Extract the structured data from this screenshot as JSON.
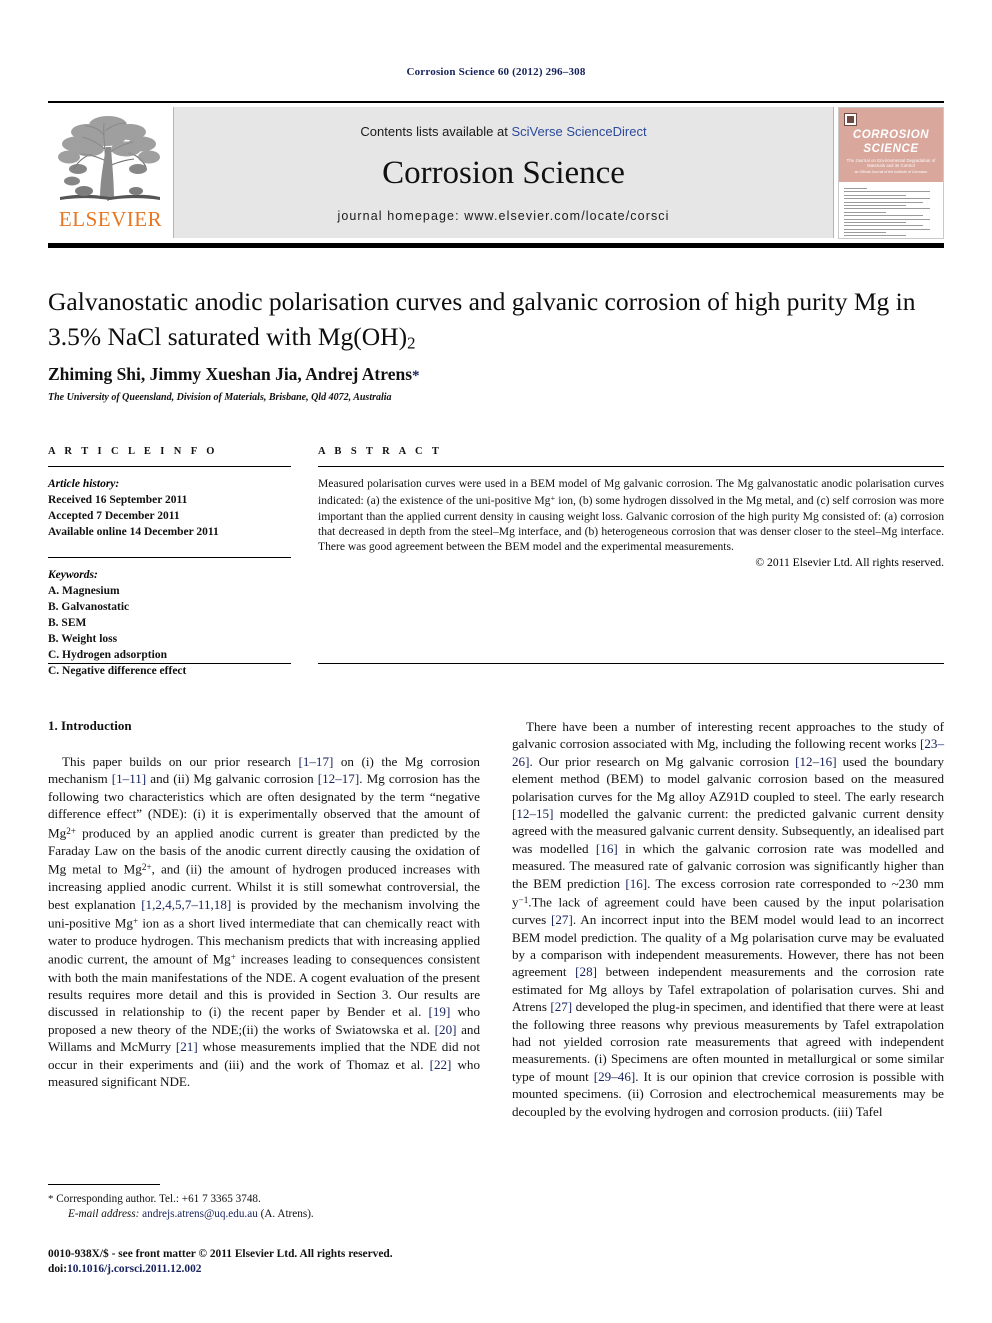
{
  "running_head": "Corrosion Science 60 (2012) 296–308",
  "masthead": {
    "publisher_logo_label": "ELSEVIER",
    "contents_prefix": "Contents lists available at ",
    "sciencedirect_link": "SciVerse ScienceDirect",
    "journal_name": "Corrosion Science",
    "homepage_line": "journal homepage: www.elsevier.com/locate/corsci",
    "cover": {
      "title_line1": "CORROSION",
      "title_line2": "SCIENCE",
      "subtitle": "The Journal on Environmental Degradation of Materials and its Control",
      "society_line": "an Official Journal of the Institute of Corrosion"
    }
  },
  "article": {
    "title_line1": "Galvanostatic anodic polarisation curves and galvanic corrosion of high purity Mg in",
    "title_line2_pre": "3.5% NaCl saturated with Mg(OH)",
    "title_line2_sub": "2",
    "authors": "Zhiming Shi, Jimmy Xueshan Jia, Andrej Atrens",
    "corresponding_marker": "*",
    "affiliation": "The University of Queensland, Division of Materials, Brisbane, Qld 4072, Australia"
  },
  "article_info": {
    "heading": "A R T I C L E   I N F O",
    "history_label": "Article history:",
    "history": [
      "Received 16 September 2011",
      "Accepted 7 December 2011",
      "Available online 14 December 2011"
    ],
    "keywords_label": "Keywords:",
    "keywords": [
      "A. Magnesium",
      "B. Galvanostatic",
      "B. SEM",
      "B. Weight loss",
      "C. Hydrogen adsorption",
      "C. Negative difference effect"
    ]
  },
  "abstract": {
    "heading": "A B S T R A C T",
    "part1": "Measured polarisation curves were used in a BEM model of Mg galvanic corrosion. The Mg galvanostatic anodic polarisation curves indicated: (a) the existence of the uni-positive Mg",
    "sup1": "+",
    "part2": " ion, (b) some hydrogen dissolved in the Mg metal, and (c) self corrosion was more important than the applied current density in causing weight loss. Galvanic corrosion of the high purity Mg consisted of: (a) corrosion that decreased in depth from the steel–Mg interface, and (b) heterogeneous corrosion that was denser closer to the steel–Mg interface. There was good agreement between the BEM model and the experimental measurements.",
    "copyright": "© 2011 Elsevier Ltd. All rights reserved."
  },
  "body": {
    "section_heading": "1. Introduction",
    "left_paragraph": {
      "s1": "This paper builds on our prior research ",
      "r1": "[1–17]",
      "s2": " on (i) the Mg corrosion mechanism ",
      "r2": "[1–11]",
      "s3": " and (ii) Mg galvanic corrosion ",
      "r3": "[12–17]",
      "s4": ". Mg corrosion has the following two characteristics which are often designated by the term “negative difference effect” (NDE): (i) it is experimentally observed that the amount of Mg",
      "sup1": "2+",
      "s5": " produced by an applied anodic current is greater than predicted by the Faraday Law on the basis of the anodic current directly causing the oxidation of Mg metal to Mg",
      "sup2": "2+",
      "s6": ", and (ii) the amount of hydrogen produced increases with increasing applied anodic current. Whilst it is still somewhat controversial, the best explanation ",
      "r4": "[1,2,4,5,7–11,18]",
      "s7": " is provided by the mechanism involving the uni-positive Mg",
      "sup3": "+",
      "s8": " ion as a short lived intermediate that can chemically react with water to produce hydrogen. This mechanism predicts that with increasing applied anodic current, the amount of Mg",
      "sup4": "+",
      "s9": " increases leading to consequences consistent with both the main manifestations of the NDE. A cogent evaluation of the present results requires more detail and this is provided in Section 3. Our results are discussed in relationship to (i) the recent paper by Bender et al. ",
      "r5": "[19]",
      "s10": " who proposed a new theory of the NDE;(ii) the works of Swiatowska et al. ",
      "r6": "[20]",
      "s11": " and Willams and McMurry ",
      "r7": "[21]",
      "s12": " whose measurements implied that the NDE did not occur in their experiments and (iii) and the work of Thomaz et al. ",
      "r8": "[22]",
      "s13": " who measured significant NDE."
    },
    "right_paragraph": {
      "s1": "There have been a number of interesting recent approaches to the study of galvanic corrosion associated with Mg, including the following recent works ",
      "r1": "[23–26]",
      "s2": ". Our prior research on Mg galvanic corrosion ",
      "r2": "[12–16]",
      "s3": " used the boundary element method (BEM) to model galvanic corrosion based on the measured polarisation curves for the Mg alloy AZ91D coupled to steel. The early research ",
      "r3": "[12–15]",
      "s4": " modelled the galvanic current: the predicted galvanic current density agreed with the measured galvanic current density. Subsequently, an idealised part was modelled ",
      "r4": "[16]",
      "s5": " in which the galvanic corrosion rate was modelled and measured. The measured rate of galvanic corrosion was significantly higher than the BEM prediction ",
      "r5": "[16]",
      "s6": ". The excess corrosion rate corresponded to ~230 mm y",
      "sup1": "−1",
      "s7": ".The lack of agreement could have been caused by the input polarisation curves ",
      "r6": "[27]",
      "s8": ". An incorrect input into the BEM model would lead to an incorrect BEM model prediction. The quality of a Mg polarisation curve may be evaluated by a comparison with independent measurements. However, there has not been agreement ",
      "r7": "[28]",
      "s9": " between independent measurements and the corrosion rate estimated for Mg alloys by Tafel extrapolation of polarisation curves. Shi and Atrens ",
      "r8": "[27]",
      "s10": " developed the plug-in specimen, and identified that there were at least the following three reasons why previous measurements by Tafel extrapolation had not yielded corrosion rate measurements that agreed with independent measurements. (i) Specimens are often mounted in metallurgical or some similar type of mount ",
      "r9": "[29–46]",
      "s11": ". It is our opinion that crevice corrosion is possible with mounted specimens. (ii) Corrosion and electrochemical measurements may be decoupled by the evolving hydrogen and corrosion products. (iii) Tafel"
    }
  },
  "footnote": {
    "star": "*",
    "corresponding": "Corresponding author. Tel.: +61 7 3365 3748.",
    "email_label": "E-mail address:",
    "email": "andrejs.atrens@uq.edu.au",
    "email_owner": "(A. Atrens)."
  },
  "imprint": {
    "line1": "0010-938X/$ - see front matter © 2011 Elsevier Ltd. All rights reserved.",
    "doi_label": "doi:",
    "doi": "10.1016/j.corsci.2011.12.002"
  }
}
